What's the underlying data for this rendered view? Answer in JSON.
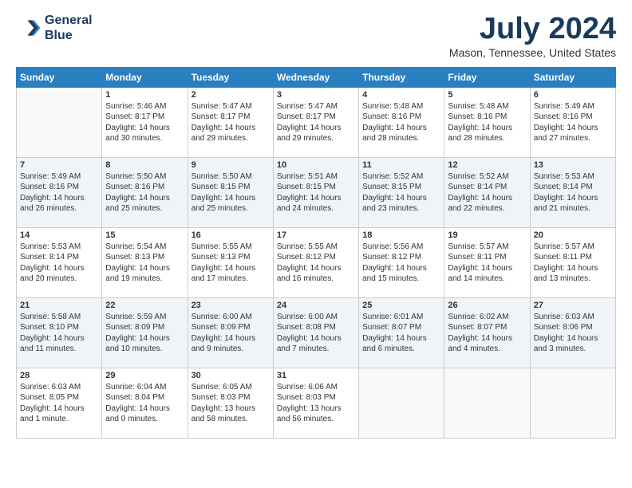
{
  "logo": {
    "line1": "General",
    "line2": "Blue"
  },
  "title": "July 2024",
  "location": "Mason, Tennessee, United States",
  "days_of_week": [
    "Sunday",
    "Monday",
    "Tuesday",
    "Wednesday",
    "Thursday",
    "Friday",
    "Saturday"
  ],
  "weeks": [
    [
      {
        "day": "",
        "content": ""
      },
      {
        "day": "1",
        "content": "Sunrise: 5:46 AM\nSunset: 8:17 PM\nDaylight: 14 hours\nand 30 minutes."
      },
      {
        "day": "2",
        "content": "Sunrise: 5:47 AM\nSunset: 8:17 PM\nDaylight: 14 hours\nand 29 minutes."
      },
      {
        "day": "3",
        "content": "Sunrise: 5:47 AM\nSunset: 8:17 PM\nDaylight: 14 hours\nand 29 minutes."
      },
      {
        "day": "4",
        "content": "Sunrise: 5:48 AM\nSunset: 8:16 PM\nDaylight: 14 hours\nand 28 minutes."
      },
      {
        "day": "5",
        "content": "Sunrise: 5:48 AM\nSunset: 8:16 PM\nDaylight: 14 hours\nand 28 minutes."
      },
      {
        "day": "6",
        "content": "Sunrise: 5:49 AM\nSunset: 8:16 PM\nDaylight: 14 hours\nand 27 minutes."
      }
    ],
    [
      {
        "day": "7",
        "content": "Sunrise: 5:49 AM\nSunset: 8:16 PM\nDaylight: 14 hours\nand 26 minutes."
      },
      {
        "day": "8",
        "content": "Sunrise: 5:50 AM\nSunset: 8:16 PM\nDaylight: 14 hours\nand 25 minutes."
      },
      {
        "day": "9",
        "content": "Sunrise: 5:50 AM\nSunset: 8:15 PM\nDaylight: 14 hours\nand 25 minutes."
      },
      {
        "day": "10",
        "content": "Sunrise: 5:51 AM\nSunset: 8:15 PM\nDaylight: 14 hours\nand 24 minutes."
      },
      {
        "day": "11",
        "content": "Sunrise: 5:52 AM\nSunset: 8:15 PM\nDaylight: 14 hours\nand 23 minutes."
      },
      {
        "day": "12",
        "content": "Sunrise: 5:52 AM\nSunset: 8:14 PM\nDaylight: 14 hours\nand 22 minutes."
      },
      {
        "day": "13",
        "content": "Sunrise: 5:53 AM\nSunset: 8:14 PM\nDaylight: 14 hours\nand 21 minutes."
      }
    ],
    [
      {
        "day": "14",
        "content": "Sunrise: 5:53 AM\nSunset: 8:14 PM\nDaylight: 14 hours\nand 20 minutes."
      },
      {
        "day": "15",
        "content": "Sunrise: 5:54 AM\nSunset: 8:13 PM\nDaylight: 14 hours\nand 19 minutes."
      },
      {
        "day": "16",
        "content": "Sunrise: 5:55 AM\nSunset: 8:13 PM\nDaylight: 14 hours\nand 17 minutes."
      },
      {
        "day": "17",
        "content": "Sunrise: 5:55 AM\nSunset: 8:12 PM\nDaylight: 14 hours\nand 16 minutes."
      },
      {
        "day": "18",
        "content": "Sunrise: 5:56 AM\nSunset: 8:12 PM\nDaylight: 14 hours\nand 15 minutes."
      },
      {
        "day": "19",
        "content": "Sunrise: 5:57 AM\nSunset: 8:11 PM\nDaylight: 14 hours\nand 14 minutes."
      },
      {
        "day": "20",
        "content": "Sunrise: 5:57 AM\nSunset: 8:11 PM\nDaylight: 14 hours\nand 13 minutes."
      }
    ],
    [
      {
        "day": "21",
        "content": "Sunrise: 5:58 AM\nSunset: 8:10 PM\nDaylight: 14 hours\nand 11 minutes."
      },
      {
        "day": "22",
        "content": "Sunrise: 5:59 AM\nSunset: 8:09 PM\nDaylight: 14 hours\nand 10 minutes."
      },
      {
        "day": "23",
        "content": "Sunrise: 6:00 AM\nSunset: 8:09 PM\nDaylight: 14 hours\nand 9 minutes."
      },
      {
        "day": "24",
        "content": "Sunrise: 6:00 AM\nSunset: 8:08 PM\nDaylight: 14 hours\nand 7 minutes."
      },
      {
        "day": "25",
        "content": "Sunrise: 6:01 AM\nSunset: 8:07 PM\nDaylight: 14 hours\nand 6 minutes."
      },
      {
        "day": "26",
        "content": "Sunrise: 6:02 AM\nSunset: 8:07 PM\nDaylight: 14 hours\nand 4 minutes."
      },
      {
        "day": "27",
        "content": "Sunrise: 6:03 AM\nSunset: 8:06 PM\nDaylight: 14 hours\nand 3 minutes."
      }
    ],
    [
      {
        "day": "28",
        "content": "Sunrise: 6:03 AM\nSunset: 8:05 PM\nDaylight: 14 hours\nand 1 minute."
      },
      {
        "day": "29",
        "content": "Sunrise: 6:04 AM\nSunset: 8:04 PM\nDaylight: 14 hours\nand 0 minutes."
      },
      {
        "day": "30",
        "content": "Sunrise: 6:05 AM\nSunset: 8:03 PM\nDaylight: 13 hours\nand 58 minutes."
      },
      {
        "day": "31",
        "content": "Sunrise: 6:06 AM\nSunset: 8:03 PM\nDaylight: 13 hours\nand 56 minutes."
      },
      {
        "day": "",
        "content": ""
      },
      {
        "day": "",
        "content": ""
      },
      {
        "day": "",
        "content": ""
      }
    ]
  ]
}
